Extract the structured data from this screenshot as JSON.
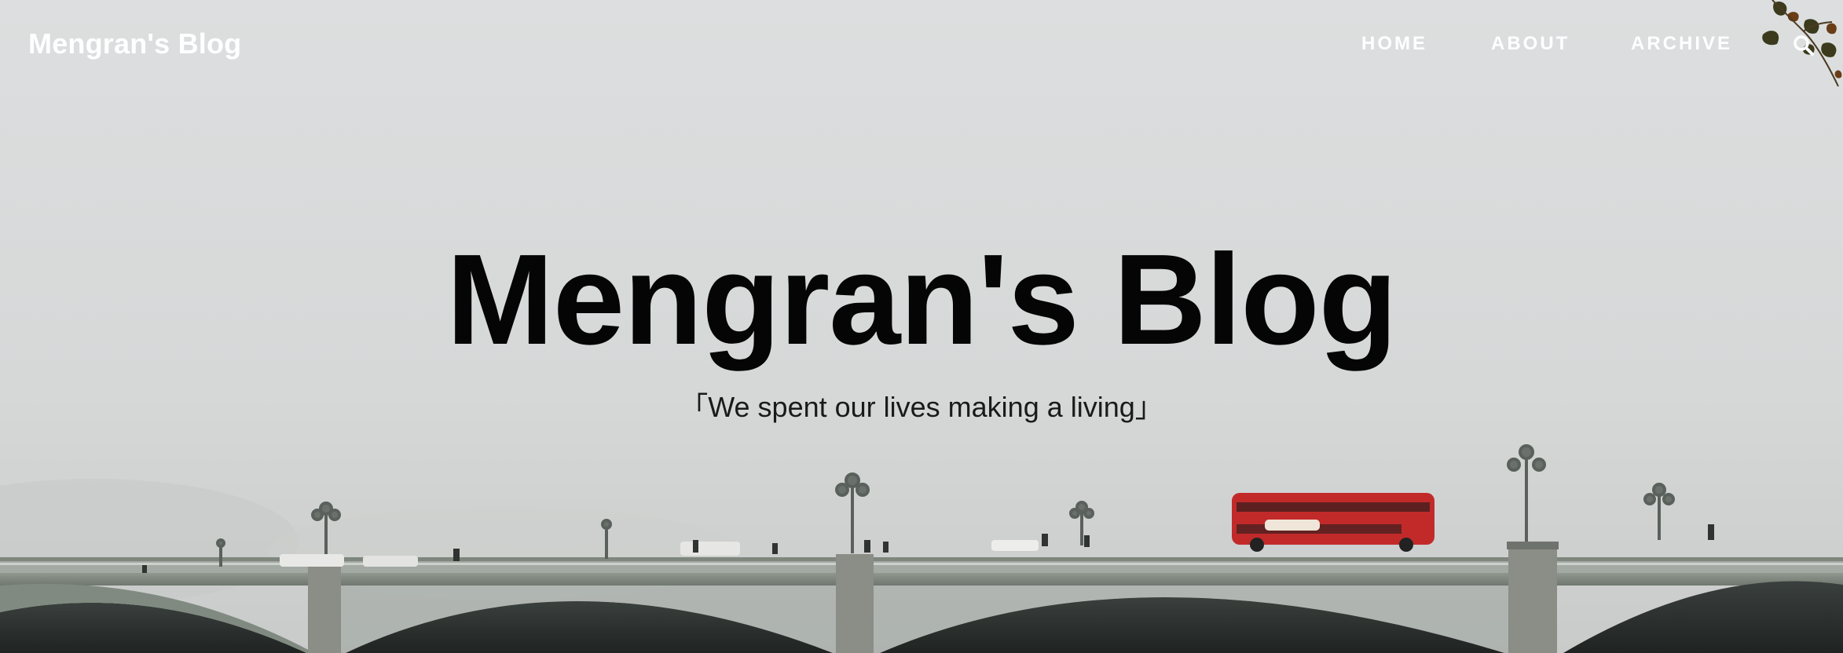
{
  "header": {
    "brand": "Mengran's Blog",
    "nav": [
      {
        "label": "HOME"
      },
      {
        "label": "ABOUT"
      },
      {
        "label": "ARCHIVE"
      }
    ],
    "search_icon": "search-icon"
  },
  "hero": {
    "title": "Mengran's Blog",
    "subtitle": "「We spent our lives making a living」",
    "background": "foggy-bridge-photo",
    "bus_color": "#c22a2a"
  }
}
